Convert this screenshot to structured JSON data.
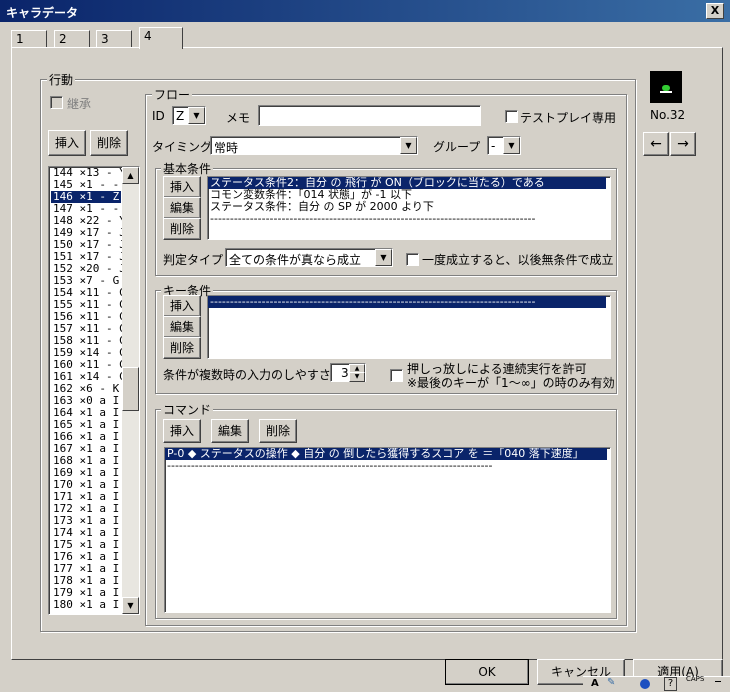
{
  "window": {
    "title": "キャラデータ",
    "close_label": "X"
  },
  "tabs": [
    "1",
    "2",
    "3",
    "4"
  ],
  "behavior": {
    "group_label": "行動",
    "inherit_label": "継承",
    "insert_label": "挿入",
    "delete_label": "削除",
    "items": [
      "144 ×13 - Y",
      "145 ×1 - -",
      "146 ×1 - Z",
      "147 ×1 - -",
      "148 ×22 - Y",
      "149 ×17 - J",
      "150 ×17 - J",
      "151 ×17 - J",
      "152 ×20 - J",
      "153 ×7 - G",
      "154 ×11 - G",
      "155 ×11 - G",
      "156 ×11 - G",
      "157 ×11 - G",
      "158 ×11 - G",
      "159 ×14 - G",
      "160 ×11 - G",
      "161 ×14 - G",
      "162 ×6 - K",
      "163 ×0 a I",
      "164 ×1 a I",
      "165 ×1 a I",
      "166 ×1 a I",
      "167 ×1 a I",
      "168 ×1 a I",
      "169 ×1 a I",
      "170 ×1 a I",
      "171 ×1 a I",
      "172 ×1 a I",
      "173 ×1 a I",
      "174 ×1 a I",
      "175 ×1 a I",
      "176 ×1 a I",
      "177 ×1 a I",
      "178 ×1 a I",
      "179 ×1 a I",
      "180 ×1 a I"
    ],
    "selected_index": 2
  },
  "flow": {
    "group_label": "フロー",
    "id_label": "ID",
    "id_value": "Z",
    "memo_label": "メモ",
    "memo_value": "",
    "testplay_label": "テストプレイ専用",
    "timing_label": "タイミング",
    "timing_value": "常時",
    "group_field_label": "グループ",
    "group_value": "-"
  },
  "basic_conditions": {
    "group_label": "基本条件",
    "insert_label": "挿入",
    "edit_label": "編集",
    "delete_label": "削除",
    "items": [
      "ステータス条件2：自分 の 飛行 が ON（ブロックに当たる）である",
      "コモン変数条件：「014 状態」が -1 以下",
      "ステータス条件：自分 の SP が 2000 より下",
      "----------------------------------------------------------------------------------"
    ],
    "judge_label": "判定タイプ",
    "judge_value": "全ての条件が真なら成立",
    "once_label": "一度成立すると、以後無条件で成立"
  },
  "key_conditions": {
    "group_label": "キー条件",
    "insert_label": "挿入",
    "edit_label": "編集",
    "delete_label": "削除",
    "items": [
      "----------------------------------------------------------------------------------"
    ],
    "ease_label": "条件が複数時の入力のしやすさ",
    "ease_value": "3",
    "hold_label": "押しっ放しによる連続実行を許可",
    "hold_note": "※最後のキーが「1～∞」の時のみ有効"
  },
  "commands": {
    "group_label": "コマンド",
    "insert_label": "挿入",
    "edit_label": "編集",
    "delete_label": "削除",
    "items": [
      "P-0 ◆ ステータスの操作 ◆ 自分 の 倒したら獲得するスコア を ＝「040 落下速度」",
      "----------------------------------------------------------------------------------"
    ]
  },
  "side": {
    "number_label": "No.32",
    "prev_label": "←",
    "next_label": "→"
  },
  "footer": {
    "ok_label": "OK",
    "cancel_label": "キャンセル",
    "apply_label": "適用(A)",
    "tray_caps": "CAPS",
    "tray_a": "A",
    "tray_q": "?"
  }
}
